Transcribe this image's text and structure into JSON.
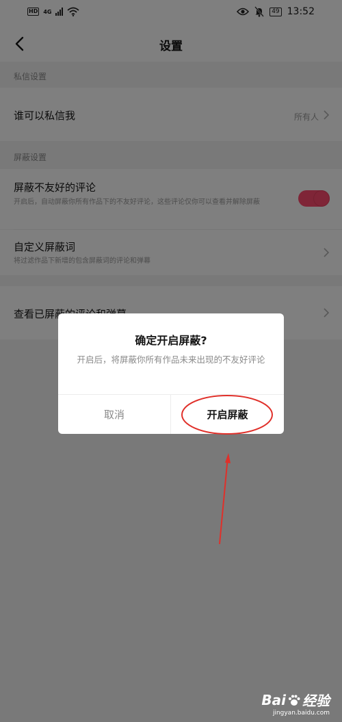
{
  "status_bar": {
    "network_hd": "HD",
    "network_gen": "4G",
    "battery": "49",
    "time": "13:52",
    "icons": [
      "eye-icon",
      "mute-bell-icon",
      "battery-icon",
      "wifi-icon",
      "signal-icon"
    ]
  },
  "nav": {
    "title": "设置",
    "back_icon": "chevron-left-icon"
  },
  "sections": {
    "message": {
      "header": "私信设置",
      "who_can_message": {
        "title": "谁可以私信我",
        "value": "所有人"
      }
    },
    "block": {
      "header": "屏蔽设置",
      "block_unfriendly": {
        "title": "屏蔽不友好的评论",
        "subtitle": "开启后，自动屏蔽你所有作品下的不友好评论，这些评论仅你可以查看并解除屏蔽",
        "enabled": true
      },
      "custom_words": {
        "title": "自定义屏蔽词",
        "subtitle": "将过滤作品下新增的包含屏蔽词的评论和弹幕"
      }
    },
    "view_blocked": {
      "title": "查看已屏蔽的评论和弹幕"
    }
  },
  "dialog": {
    "title": "确定开启屏蔽?",
    "message": "开启后，将屏蔽你所有作品未来出现的不友好评论",
    "cancel_label": "取消",
    "confirm_label": "开启屏蔽"
  },
  "annotation_color": "#e0302a",
  "accent_color": "#fe2c55",
  "watermark": {
    "logo_left": "Bai",
    "logo_right": "经验",
    "url": "jingyan.baidu.com"
  }
}
